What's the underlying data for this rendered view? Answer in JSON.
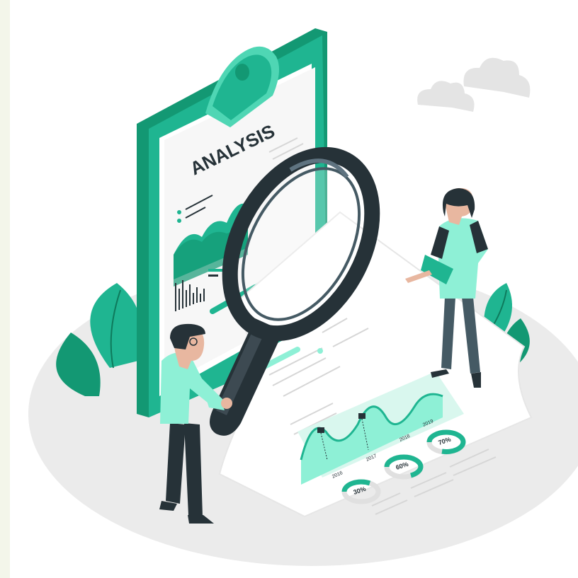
{
  "illustration": {
    "clipboard_title": "ANALYSIS",
    "timeline_years": [
      "2016",
      "2017",
      "2018",
      "2019"
    ],
    "donut_labels": [
      {
        "text": "30%",
        "fraction": 0.3
      },
      {
        "text": "60%",
        "fraction": 0.6
      },
      {
        "text": "70%",
        "fraction": 0.7
      }
    ]
  },
  "colors": {
    "background": "#f3f6ea",
    "canvas": "#ffffff",
    "accent": "#1fb591",
    "accent_dark": "#139873",
    "accent_light": "#8ef0d6",
    "dark": "#263238",
    "grey_floor": "#ebebeb",
    "cloud": "#e0e0e0"
  },
  "icons": [
    "magnifier-icon",
    "clipboard-icon",
    "cloud-icon",
    "leaf-plant-icon",
    "donut-chart-icon",
    "area-chart-icon",
    "bar-chart-icon"
  ]
}
